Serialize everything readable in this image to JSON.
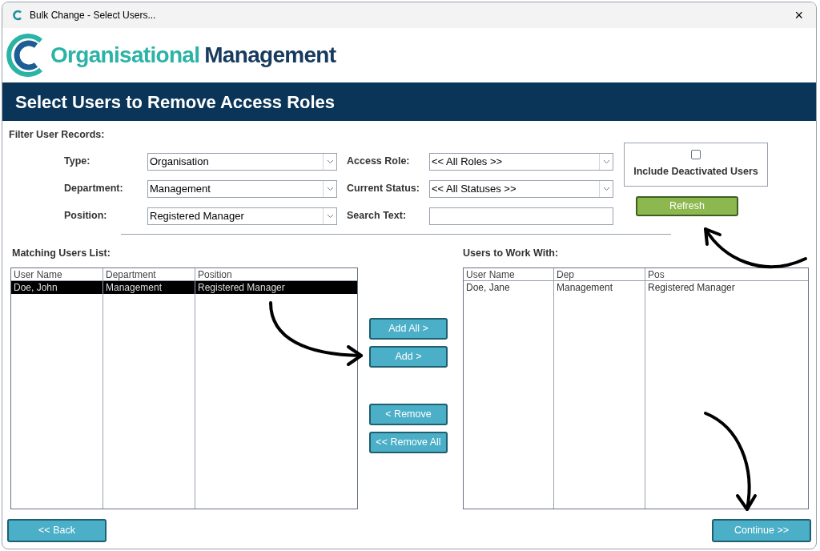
{
  "window": {
    "title": "Bulk Change - Select Users...",
    "close": "×"
  },
  "logo": {
    "primary": "Organisational",
    "secondary": "Management"
  },
  "banner": {
    "title": "Select Users to Remove Access Roles"
  },
  "filter": {
    "heading": "Filter User Records:",
    "left_fields": [
      {
        "label": "Type:",
        "kind": "dropdown",
        "value": "Organisation"
      },
      {
        "label": "Department:",
        "kind": "dropdown",
        "value": "Management"
      },
      {
        "label": "Position:",
        "kind": "dropdown",
        "value": "Registered Manager"
      }
    ],
    "right_fields": [
      {
        "label": "Access Role:",
        "kind": "dropdown",
        "value": "<< All Roles >>"
      },
      {
        "label": "Current Status:",
        "kind": "dropdown",
        "value": "<< All Statuses >>"
      },
      {
        "label": "Search Text:",
        "kind": "text"
      }
    ],
    "include_deactivated": {
      "label": "Include Deactivated Users",
      "checked": false
    },
    "refresh": "Refresh"
  },
  "matching_list": {
    "heading": "Matching Users List:",
    "columns": [
      "User Name",
      "Department",
      "Position"
    ],
    "rows": [
      {
        "cells": [
          "Doe, John",
          "Management",
          "Registered Manager"
        ],
        "selected": true
      }
    ]
  },
  "transfer_buttons": [
    "Add All >",
    "Add >",
    "< Remove",
    "<< Remove All"
  ],
  "work_list": {
    "heading": "Users to Work With:",
    "columns": [
      "User Name",
      "Dep",
      "Pos"
    ],
    "rows": [
      {
        "cells": [
          "Doe, Jane",
          "Management",
          "Registered Manager"
        ],
        "selected": false
      }
    ]
  },
  "footer": {
    "back": "<< Back",
    "continue": "Continue >>"
  }
}
